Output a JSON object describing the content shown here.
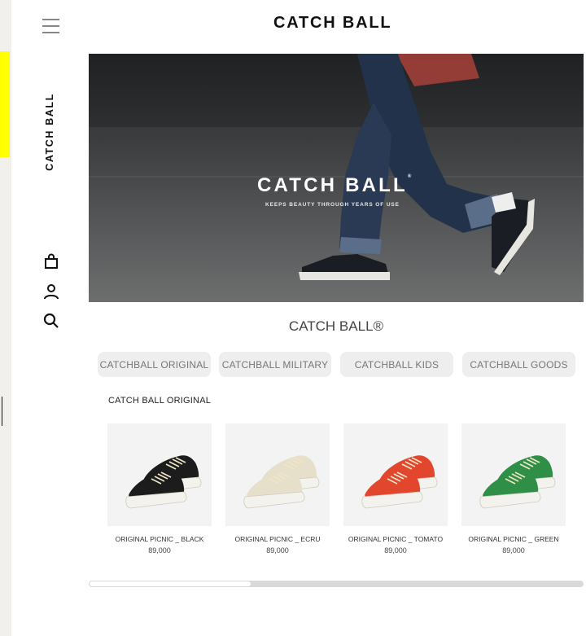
{
  "header": {
    "logo_text": "CATCH BALL"
  },
  "sidebar": {
    "logo_text": "CATCH BALL",
    "icons": [
      "menu-icon",
      "shopping-bag-icon",
      "user-icon",
      "search-icon"
    ]
  },
  "hero": {
    "title": "CATCH BALL",
    "registered_mark": "®",
    "tagline": "KEEPS BEAUTY THROUGH YEARS OF USE"
  },
  "section": {
    "title": "CATCH BALL®"
  },
  "tabs": [
    {
      "label": "CATCHBALL ORIGINAL"
    },
    {
      "label": "CATCHBALL MILITARY"
    },
    {
      "label": "CATCHBALL KIDS"
    },
    {
      "label": "CATCHBALL GOODS"
    }
  ],
  "subsection": {
    "title": "CATCH BALL ORIGINAL"
  },
  "products": [
    {
      "name": "ORIGINAL PICNIC _ BLACK",
      "price": "89,000",
      "color": "#1c1c1c"
    },
    {
      "name": "ORIGINAL PICNIC _ ECRU",
      "price": "89,000",
      "color": "#e6dfc9"
    },
    {
      "name": "ORIGINAL PICNIC _ TOMATO",
      "price": "89,000",
      "color": "#e2472e"
    },
    {
      "name": "ORIGINAL PICNIC _ GREEN",
      "price": "89,000",
      "color": "#2f8f47"
    }
  ],
  "colors": {
    "accent_yellow": "#ffff00",
    "brand_text": "#111111"
  }
}
